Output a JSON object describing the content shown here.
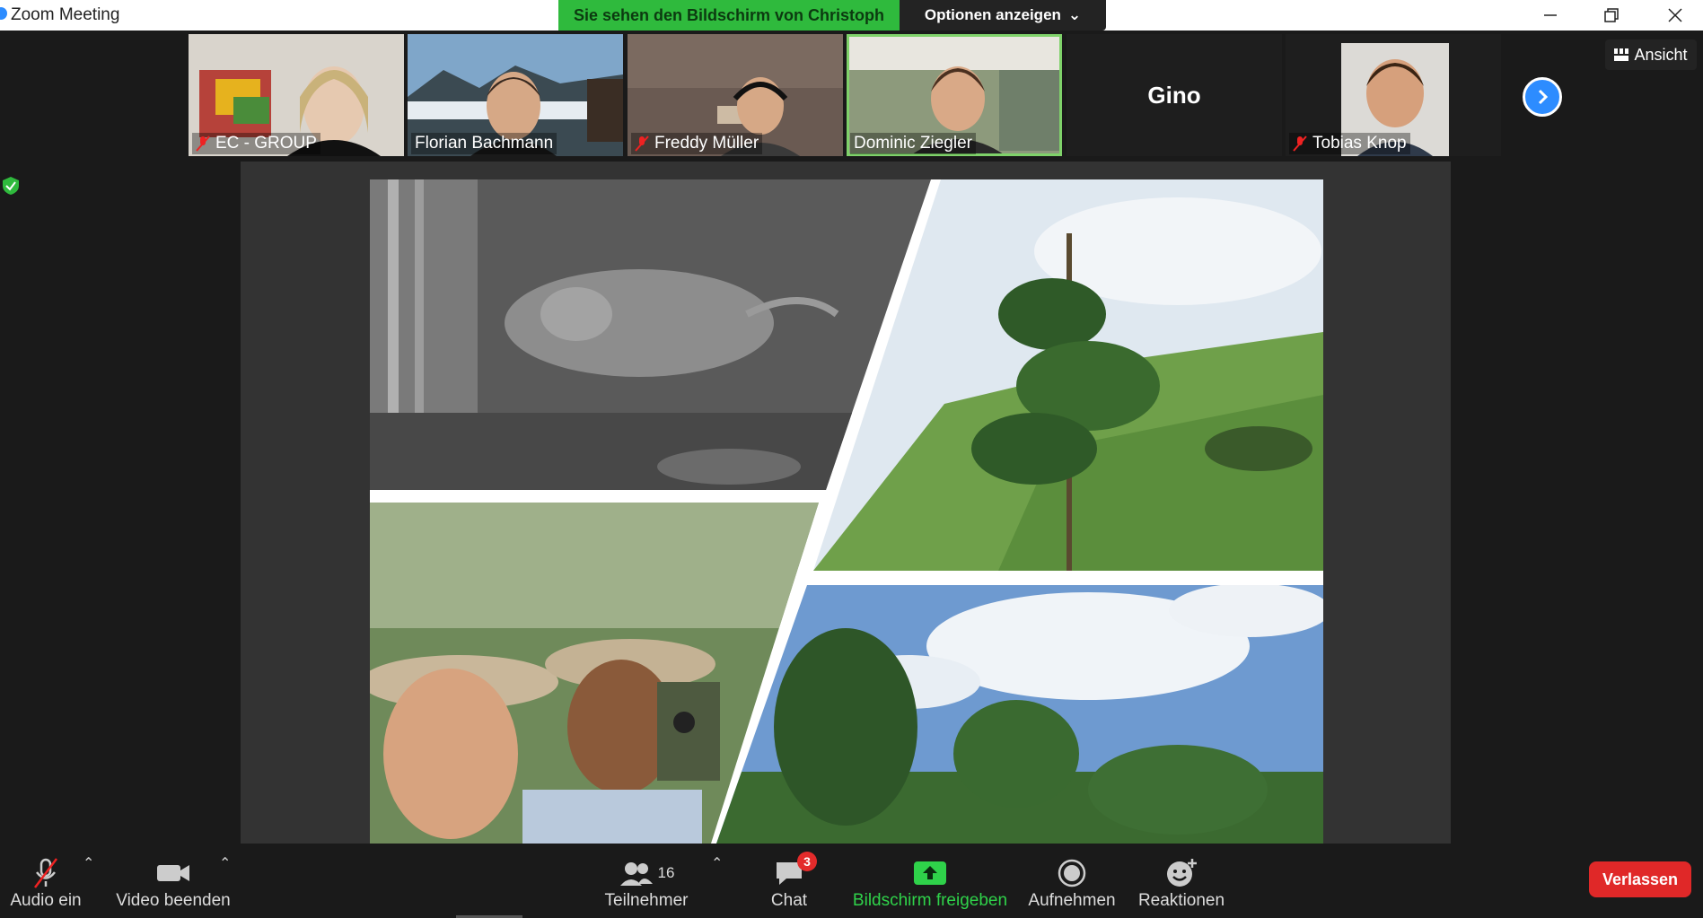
{
  "window": {
    "title": "Zoom Meeting"
  },
  "share": {
    "banner_text": "Sie sehen den Bildschirm von Christoph",
    "options_label": "Optionen anzeigen"
  },
  "participants": [
    {
      "name": "EC - GROUP",
      "muted": true
    },
    {
      "name": "Florian Bachmann",
      "muted": false
    },
    {
      "name": "Freddy Müller",
      "muted": true
    },
    {
      "name": "Dominic Ziegler",
      "muted": false,
      "active": true
    },
    {
      "name": "Gino",
      "muted": false
    },
    {
      "name": "Tobias Knop",
      "muted": true
    }
  ],
  "view_label": "Ansicht",
  "toolbar": {
    "audio_label": "Audio ein",
    "video_label": "Video beenden",
    "participants_label": "Teilnehmer",
    "participants_count": "16",
    "chat_label": "Chat",
    "chat_badge": "3",
    "share_label": "Bildschirm freigeben",
    "record_label": "Aufnehmen",
    "reactions_label": "Reaktionen",
    "leave_label": "Verlassen"
  },
  "colors": {
    "share_green": "#2fba3d",
    "accent_blue": "#2d8cff",
    "leave_red": "#e02828",
    "active_outline": "#7fd26a"
  }
}
